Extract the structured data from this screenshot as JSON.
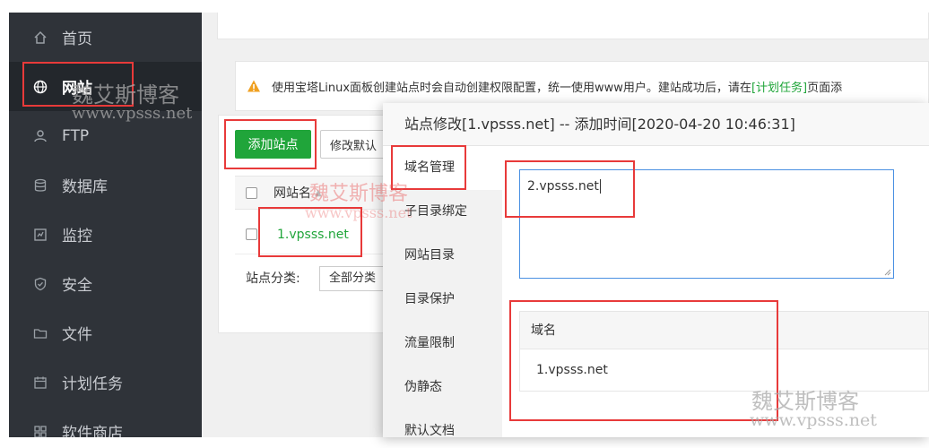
{
  "sidebar": {
    "items": [
      {
        "label": "首页",
        "icon": "home-icon"
      },
      {
        "label": "网站",
        "icon": "globe-icon",
        "active": true
      },
      {
        "label": "FTP",
        "icon": "user-icon"
      },
      {
        "label": "数据库",
        "icon": "database-icon"
      },
      {
        "label": "监控",
        "icon": "monitor-icon"
      },
      {
        "label": "安全",
        "icon": "shield-icon"
      },
      {
        "label": "文件",
        "icon": "folder-icon"
      },
      {
        "label": "计划任务",
        "icon": "calendar-icon"
      },
      {
        "label": "软件商店",
        "icon": "grid-icon"
      }
    ]
  },
  "notice": {
    "text_before": "使用宝塔Linux面板创建站点时会自动创建权限配置，统一使用www用户。建站成功后，请在",
    "link": "[计划任务]",
    "text_after": "页面添"
  },
  "toolbar": {
    "add_site": "添加站点",
    "modify_default": "修改默认"
  },
  "site_table": {
    "header": "网站名",
    "rows": [
      {
        "name": "1.vpsss.net"
      }
    ]
  },
  "category": {
    "label": "站点分类:",
    "selected": "全部分类"
  },
  "modal": {
    "title": "站点修改[1.vpsss.net] -- 添加时间[2020-04-20 10:46:31]",
    "tabs": [
      "域名管理",
      "子目录绑定",
      "网站目录",
      "目录保护",
      "流量限制",
      "伪静态",
      "默认文档"
    ],
    "domain_input_value": "2.vpsss.net",
    "domain_table": {
      "header": "域名",
      "rows": [
        "1.vpsss.net"
      ]
    }
  },
  "watermark": {
    "cn": "魏艾斯博客",
    "url": "www.vpsss.net"
  },
  "colors": {
    "accent": "#20a53a",
    "sidebar": "#2f3339",
    "annotation": "#e83a3a",
    "focus": "#4a90e2"
  }
}
